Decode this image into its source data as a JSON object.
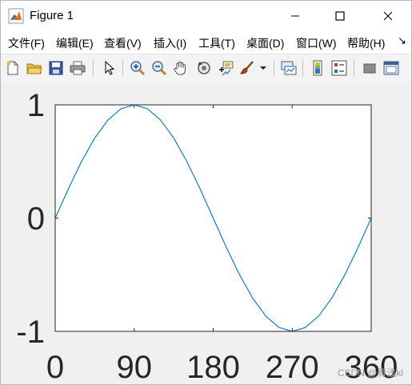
{
  "window": {
    "title": "Figure 1",
    "app_icon": "matlab-icon",
    "controls": [
      "minimize-icon",
      "maximize-icon",
      "close-icon"
    ]
  },
  "menu": {
    "items": [
      {
        "label": "文件(F)"
      },
      {
        "label": "编辑(E)"
      },
      {
        "label": "查看(V)"
      },
      {
        "label": "插入(I)"
      },
      {
        "label": "工具(T)"
      },
      {
        "label": "桌面(D)"
      },
      {
        "label": "窗口(W)"
      },
      {
        "label": "帮助(H)"
      }
    ],
    "overflow": "↘"
  },
  "toolbar": {
    "buttons": [
      "new-figure-icon",
      "open-file-icon",
      "save-icon",
      "print-icon",
      "pointer-icon",
      "zoom-in-icon",
      "zoom-out-icon",
      "pan-hand-icon",
      "rotate-3d-icon",
      "data-cursor-icon",
      "brush-icon",
      "link-plot-icon",
      "colorbar-icon",
      "legend-icon",
      "hide-tools-icon",
      "dock-icon"
    ]
  },
  "chart_data": {
    "type": "line",
    "title": "",
    "xlabel": "",
    "ylabel": "",
    "xlim": [
      0,
      360
    ],
    "ylim": [
      -1,
      1
    ],
    "xticks": [
      "0",
      "90",
      "180",
      "270",
      "360"
    ],
    "yticks": [
      "1",
      "0",
      "-1"
    ],
    "grid": false,
    "series": [
      {
        "color": "#0072bd",
        "x": [
          0,
          15,
          30,
          45,
          60,
          75,
          90,
          105,
          120,
          135,
          150,
          165,
          180,
          195,
          210,
          225,
          240,
          255,
          270,
          285,
          300,
          315,
          330,
          345,
          360
        ],
        "y": [
          0,
          0.259,
          0.5,
          0.707,
          0.866,
          0.966,
          1,
          0.966,
          0.866,
          0.707,
          0.5,
          0.259,
          0,
          -0.259,
          -0.5,
          -0.707,
          -0.866,
          -0.966,
          -1,
          -0.966,
          -0.866,
          -0.707,
          -0.5,
          -0.259,
          0
        ]
      }
    ]
  },
  "watermark": "CSDN @青浅kl"
}
